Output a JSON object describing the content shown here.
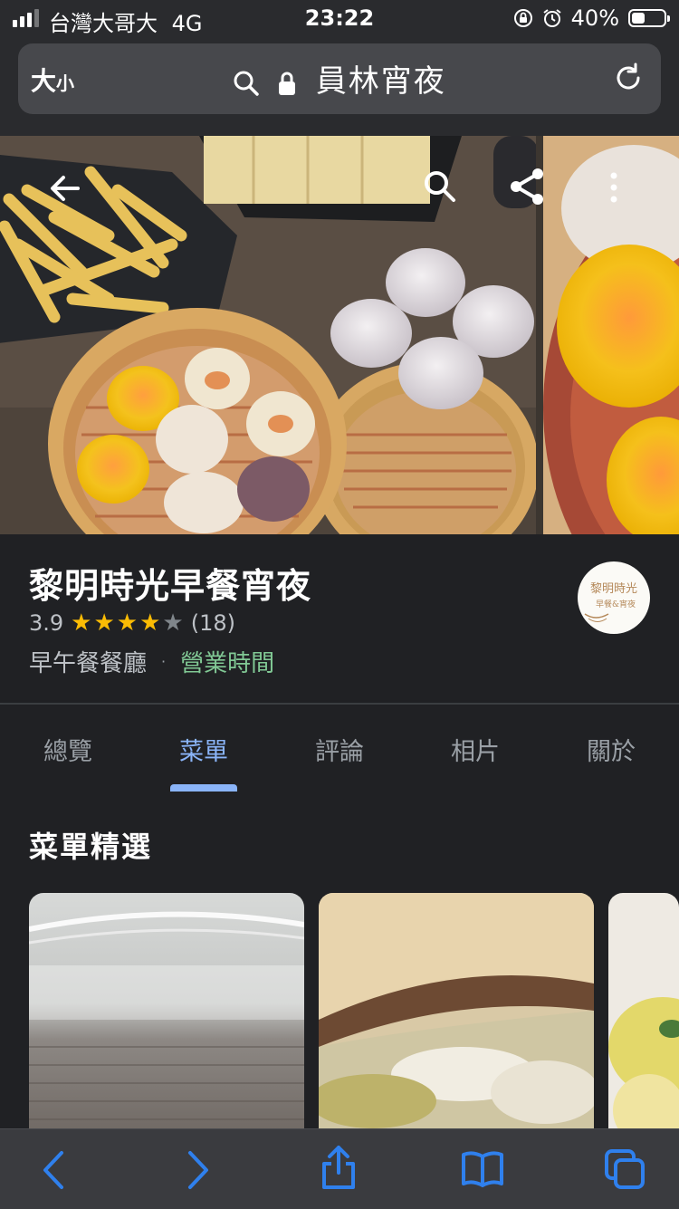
{
  "status_bar": {
    "carrier": "台灣大哥大",
    "network": "4G",
    "time": "23:22",
    "battery_percent": "40%",
    "battery_level": 0.4,
    "signal_bars": 3
  },
  "url_bar": {
    "text_size_label_large": "大",
    "text_size_label_small": "小",
    "title": "員林宵夜"
  },
  "place": {
    "name": "黎明時光早餐宵夜",
    "rating": "3.9",
    "stars_filled": 4,
    "review_count": "(18)",
    "category": "早午餐餐廳",
    "separator": "·",
    "hours_label": "營業時間",
    "logo_text_main": "黎明時光",
    "logo_text_sub": "早餐&宵夜"
  },
  "tabs": [
    {
      "label": "總覽",
      "active": false
    },
    {
      "label": "菜單",
      "active": true
    },
    {
      "label": "評論",
      "active": false
    },
    {
      "label": "相片",
      "active": false
    },
    {
      "label": "關於",
      "active": false
    }
  ],
  "menu_section": {
    "title": "菜單精選"
  },
  "colors": {
    "background": "#202124",
    "accent_blue": "#8ab4f8",
    "open_green": "#81c995",
    "star_yellow": "#fbbc04",
    "toolbar_icon": "#2f80ed"
  }
}
